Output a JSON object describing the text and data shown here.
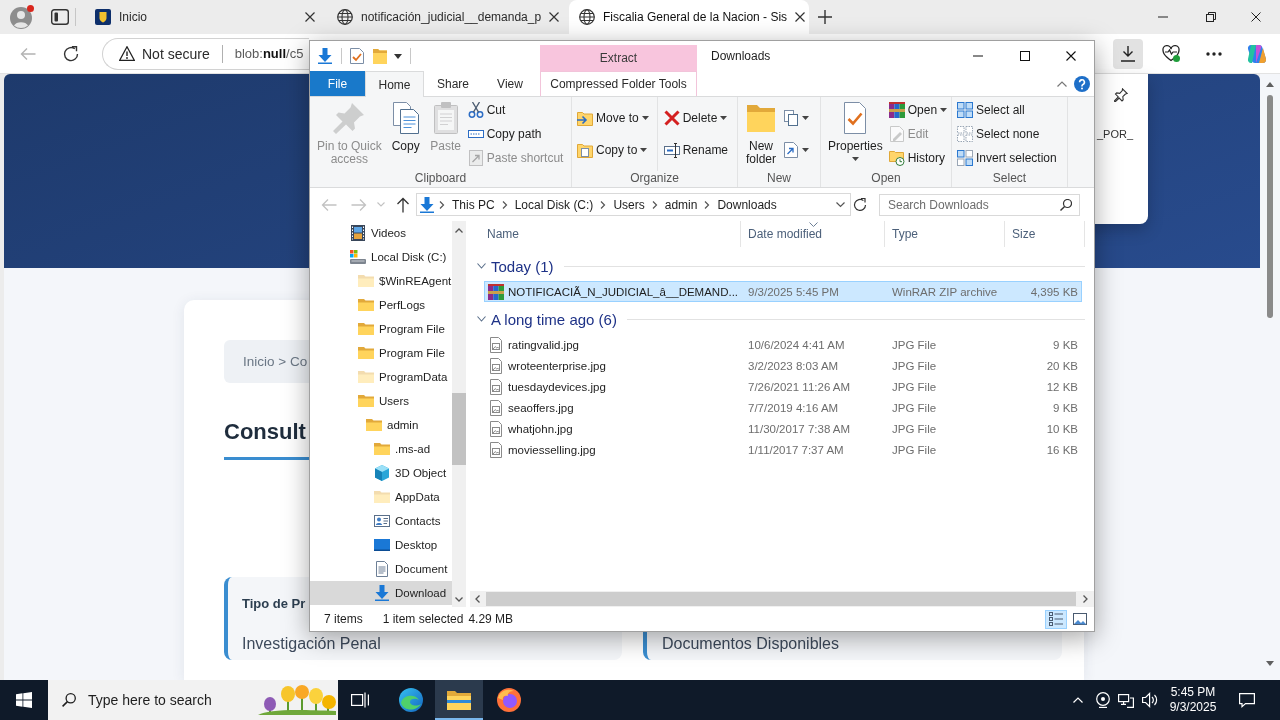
{
  "browser": {
    "tabs": [
      {
        "title": "Inicio",
        "kind": "emblem",
        "selected": false
      },
      {
        "title": "notificación_judicial__demanda_p",
        "kind": "globe",
        "selected": false
      },
      {
        "title": "Fiscalia General de la Nacion - Sis",
        "kind": "globe",
        "selected": true
      }
    ],
    "back": {
      "disabled": true
    },
    "address": {
      "security": "Not secure",
      "url": "blob:**null**/c5"
    },
    "toolbar_buttons": [
      {
        "selected": true
      },
      {
        "selected": false
      },
      {
        "selected": false
      },
      {
        "selected": false
      }
    ]
  },
  "page": {
    "breadcrumb": "Inicio > Co",
    "heading": "Consult",
    "info_boxes": [
      {
        "label": "Tipo de Pr",
        "value": "Investigación Penal"
      },
      {
        "value": "Documentos Disponibles"
      }
    ]
  },
  "downloads_panel": {
    "file_name": "_POR_"
  },
  "explorer": {
    "title": "Downloads",
    "context_tab": {
      "header": "Extract",
      "label": "Compressed Folder Tools",
      "selected": false
    },
    "ribbon_tabs": [
      {
        "label": "File",
        "kind": "menu",
        "selected": false
      },
      {
        "label": "Home",
        "kind": "tab",
        "selected": true
      },
      {
        "label": "Share",
        "kind": "tab",
        "selected": false
      },
      {
        "label": "View",
        "kind": "tab",
        "selected": false
      }
    ],
    "ribbon_groups": [
      {
        "label": "Clipboard",
        "columns": [
          [
            {
              "label": "Pin to Quick\naccess",
              "kind": "large",
              "disabled": true,
              "dropdown": false
            }
          ],
          [
            {
              "label": "Copy",
              "kind": "large",
              "disabled": false,
              "dropdown": false
            }
          ],
          [
            {
              "label": "Paste",
              "kind": "large",
              "disabled": true,
              "dropdown": false
            }
          ],
          [
            {
              "label": "Cut",
              "kind": "small",
              "disabled": false,
              "dropdown": false
            },
            {
              "label": "Copy path",
              "kind": "small",
              "disabled": false,
              "dropdown": false
            },
            {
              "label": "Paste shortcut",
              "kind": "small",
              "disabled": true,
              "dropdown": false
            }
          ]
        ]
      },
      {
        "label": "Organize",
        "columns": [
          [
            {
              "label": "Move to",
              "kind": "small",
              "disabled": false,
              "dropdown": true
            },
            {
              "label": "Copy to",
              "kind": "small",
              "disabled": false,
              "dropdown": true
            }
          ],
          [
            {
              "label": "Delete",
              "kind": "small",
              "disabled": false,
              "dropdown": true
            },
            {
              "label": "Rename",
              "kind": "small",
              "disabled": false,
              "dropdown": false
            }
          ]
        ]
      },
      {
        "label": "New",
        "columns": [
          [
            {
              "label": "New\nfolder",
              "kind": "large",
              "disabled": false,
              "dropdown": false
            }
          ],
          [
            {
              "kind": "small",
              "disabled": false,
              "dropdown": true
            },
            {
              "kind": "small",
              "disabled": false,
              "dropdown": true
            }
          ]
        ]
      },
      {
        "label": "Open",
        "columns": [
          [
            {
              "label": "Properties",
              "kind": "large",
              "disabled": false,
              "dropdown": true
            }
          ],
          [
            {
              "label": "Open",
              "kind": "small",
              "disabled": false,
              "dropdown": true
            },
            {
              "label": "Edit",
              "kind": "small",
              "disabled": true,
              "dropdown": false
            },
            {
              "label": "History",
              "kind": "small",
              "disabled": false,
              "dropdown": false
            }
          ]
        ]
      },
      {
        "label": "Select",
        "columns": [
          [
            {
              "label": "Select all",
              "kind": "small",
              "disabled": false,
              "dropdown": false
            },
            {
              "label": "Select none",
              "kind": "small",
              "disabled": false,
              "dropdown": false
            },
            {
              "label": "Invert selection",
              "kind": "small",
              "disabled": false,
              "dropdown": false
            }
          ]
        ]
      }
    ],
    "nav_buttons": [
      {
        "disabled": true
      },
      {
        "disabled": true
      },
      {
        "disabled": true
      },
      {
        "disabled": false
      }
    ],
    "path": [
      "This PC",
      "Local Disk (C:)",
      "Users",
      "admin",
      "Downloads"
    ],
    "search": {
      "placeholder": "Search Downloads"
    },
    "nav_tree": [
      {
        "label": "Videos",
        "kind": "videos",
        "hidden": false,
        "selected": false
      },
      {
        "label": "Local Disk (C:)",
        "kind": "drive",
        "hidden": false,
        "selected": false,
        "children": [
          {
            "label": "$WinREAgent",
            "kind": "folder",
            "hidden": true,
            "selected": false
          },
          {
            "label": "PerfLogs",
            "kind": "folder",
            "hidden": false,
            "selected": false
          },
          {
            "label": "Program File",
            "kind": "folder",
            "hidden": false,
            "selected": false
          },
          {
            "label": "Program File",
            "kind": "folder",
            "hidden": false,
            "selected": false
          },
          {
            "label": "ProgramData",
            "kind": "folder",
            "hidden": true,
            "selected": false
          },
          {
            "label": "Users",
            "kind": "folder",
            "hidden": false,
            "selected": false,
            "children": [
              {
                "label": "admin",
                "kind": "folder",
                "hidden": false,
                "selected": false,
                "children": [
                  {
                    "label": ".ms-ad",
                    "kind": "folder",
                    "hidden": false,
                    "selected": false
                  },
                  {
                    "label": "3D Object",
                    "kind": "objects",
                    "hidden": false,
                    "selected": false
                  },
                  {
                    "label": "AppData",
                    "kind": "folder",
                    "hidden": true,
                    "selected": false
                  },
                  {
                    "label": "Contacts",
                    "kind": "contacts",
                    "hidden": false,
                    "selected": false
                  },
                  {
                    "label": "Desktop",
                    "kind": "desktop",
                    "hidden": false,
                    "selected": false
                  },
                  {
                    "label": "Document",
                    "kind": "documents",
                    "hidden": false,
                    "selected": false
                  },
                  {
                    "label": "Download",
                    "kind": "downloads",
                    "hidden": false,
                    "selected": true
                  }
                ]
              }
            ]
          }
        ]
      }
    ],
    "columns": [
      {
        "label": "Name",
        "sorted": false
      },
      {
        "label": "Date modified",
        "sorted": true
      },
      {
        "label": "Type",
        "sorted": false
      },
      {
        "label": "Size",
        "sorted": false
      }
    ],
    "groups": [
      {
        "label": "Today (1)",
        "expanded": true,
        "files": [
          {
            "name": "NOTIFICACIÃ_N_JUDICIAL_â__DEMAND...",
            "date": "9/3/2025 5:45 PM",
            "type": "WinRAR ZIP archive",
            "size": "4,395 KB",
            "kind": "archive",
            "selected": true
          }
        ]
      },
      {
        "label": "A long time ago (6)",
        "expanded": true,
        "files": [
          {
            "name": "ratingvalid.jpg",
            "date": "10/6/2024 4:41 AM",
            "type": "JPG File",
            "size": "9 KB",
            "kind": "image",
            "selected": false
          },
          {
            "name": "wroteenterprise.jpg",
            "date": "3/2/2023 8:03 AM",
            "type": "JPG File",
            "size": "20 KB",
            "kind": "image",
            "selected": false
          },
          {
            "name": "tuesdaydevices.jpg",
            "date": "7/26/2021 11:26 AM",
            "type": "JPG File",
            "size": "12 KB",
            "kind": "image",
            "selected": false
          },
          {
            "name": "seaoffers.jpg",
            "date": "7/7/2019 4:16 AM",
            "type": "JPG File",
            "size": "9 KB",
            "kind": "image",
            "selected": false
          },
          {
            "name": "whatjohn.jpg",
            "date": "11/30/2017 7:38 AM",
            "type": "JPG File",
            "size": "10 KB",
            "kind": "image",
            "selected": false
          },
          {
            "name": "moviesselling.jpg",
            "date": "1/11/2017 7:37 AM",
            "type": "JPG File",
            "size": "16 KB",
            "kind": "image",
            "selected": false
          }
        ]
      }
    ],
    "status": {
      "count": "7 items",
      "selection": "1 item selected",
      "size": "4.29 MB"
    },
    "view_buttons": [
      {
        "selected": true
      },
      {
        "selected": false
      }
    ]
  },
  "taskbar": {
    "search": {
      "placeholder": "Type here to search"
    },
    "apps": [
      {
        "selected": false
      },
      {
        "selected": false
      },
      {
        "selected": true
      },
      {
        "selected": false
      }
    ],
    "clock": {
      "time": "5:45 PM",
      "date": "9/3/2025"
    }
  }
}
